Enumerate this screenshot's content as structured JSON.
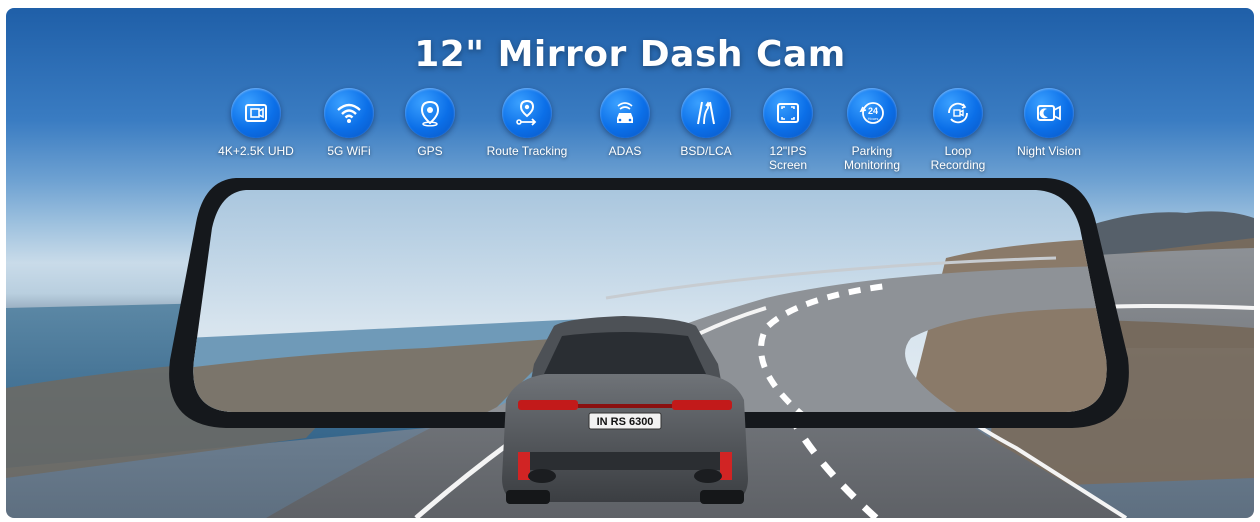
{
  "banner": {
    "title": "12\" Mirror Dash Cam",
    "features": [
      {
        "icon": "4k-camera-icon",
        "label": "4K+2.5K UHD"
      },
      {
        "icon": "wifi-icon",
        "label": "5G WiFi"
      },
      {
        "icon": "location-pin-icon",
        "label": "GPS"
      },
      {
        "icon": "route-pin-icon",
        "label": "Route Tracking"
      },
      {
        "icon": "adas-car-icon",
        "label": "ADAS"
      },
      {
        "icon": "lane-change-icon",
        "label": "BSD/LCA"
      },
      {
        "icon": "screen-frame-icon",
        "label": "12\"IPS Screen"
      },
      {
        "icon": "24-hours-icon",
        "label": "Parking Monitoring",
        "badge_text": "24",
        "badge_sub": "Hours"
      },
      {
        "icon": "loop-camera-icon",
        "label": "Loop Recording"
      },
      {
        "icon": "night-vision-icon",
        "label": "Night Vision"
      }
    ],
    "license_plate": "IN RS 6300"
  },
  "colors": {
    "badge_blue": "#0b6fe8",
    "sky_top": "#1f5fa8",
    "road": "#6b6e72",
    "mirror_frame": "#15181c"
  }
}
